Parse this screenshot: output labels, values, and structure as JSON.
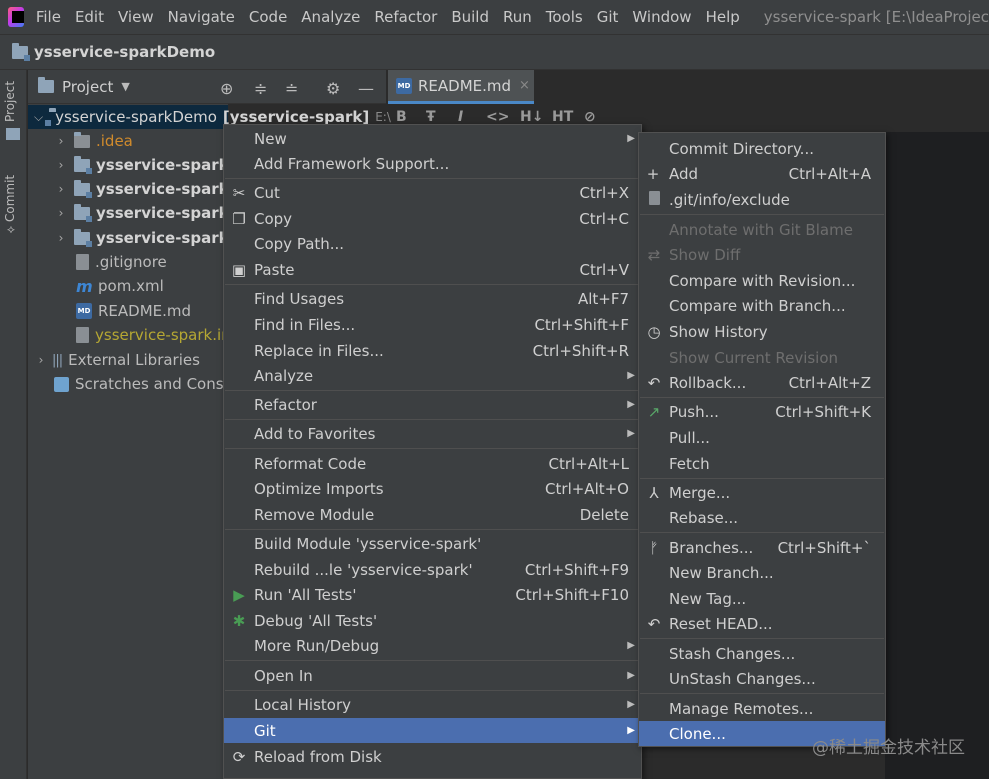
{
  "menubar": {
    "items": [
      "File",
      "Edit",
      "View",
      "Navigate",
      "Code",
      "Analyze",
      "Refactor",
      "Build",
      "Run",
      "Tools",
      "Git",
      "Window",
      "Help"
    ],
    "window_title": "ysservice-spark [E:\\IdeaProjec"
  },
  "project_bar": {
    "name": "ysservice-sparkDemo"
  },
  "left_strip": {
    "project_tab": "Project",
    "commit_tab": "Commit"
  },
  "tool_window": {
    "title": "Project"
  },
  "editor_tab": {
    "icon_text": "MD",
    "label": "README.md",
    "close": "×"
  },
  "editor_toolbar": [
    "B",
    "Ŧ",
    "I",
    "<>",
    "H↓",
    "HT",
    "⊘"
  ],
  "tree": {
    "root_label": "ysservice-sparkDemo",
    "root_bracket": "[ysservice-spark]",
    "root_path": "E:\\",
    "idea": ".idea",
    "modules": [
      "ysservice-spark-",
      "ysservice-spark-",
      "ysservice-spark-",
      "ysservice-spark-"
    ],
    "gitignore": ".gitignore",
    "pom": "pom.xml",
    "readme": "README.md",
    "iml": "ysservice-spark.im",
    "external_libraries": "External Libraries",
    "scratches": "Scratches and Conso"
  },
  "context_menu": {
    "items": [
      {
        "label": "New",
        "shortcut": "",
        "submenu": true
      },
      {
        "label": "Add Framework Support...",
        "shortcut": ""
      },
      {
        "label": "Cut",
        "shortcut": "Ctrl+X",
        "icon": "scissors-icon"
      },
      {
        "label": "Copy",
        "shortcut": "Ctrl+C",
        "icon": "copy-icon"
      },
      {
        "label": "Copy Path...",
        "shortcut": ""
      },
      {
        "label": "Paste",
        "shortcut": "Ctrl+V",
        "icon": "paste-icon"
      },
      {
        "label": "Find Usages",
        "shortcut": "Alt+F7"
      },
      {
        "label": "Find in Files...",
        "shortcut": "Ctrl+Shift+F"
      },
      {
        "label": "Replace in Files...",
        "shortcut": "Ctrl+Shift+R"
      },
      {
        "label": "Analyze",
        "shortcut": "",
        "submenu": true
      },
      {
        "label": "Refactor",
        "shortcut": "",
        "submenu": true
      },
      {
        "label": "Add to Favorites",
        "shortcut": "",
        "submenu": true
      },
      {
        "label": "Reformat Code",
        "shortcut": "Ctrl+Alt+L"
      },
      {
        "label": "Optimize Imports",
        "shortcut": "Ctrl+Alt+O"
      },
      {
        "label": "Remove Module",
        "shortcut": "Delete"
      },
      {
        "label": "Build Module 'ysservice-spark'",
        "shortcut": ""
      },
      {
        "label": "Rebuild ...le 'ysservice-spark'",
        "shortcut": "Ctrl+Shift+F9"
      },
      {
        "label": "Run 'All Tests'",
        "shortcut": "Ctrl+Shift+F10",
        "icon": "run-icon"
      },
      {
        "label": "Debug 'All Tests'",
        "shortcut": "",
        "icon": "bug-icon"
      },
      {
        "label": "More Run/Debug",
        "shortcut": "",
        "submenu": true
      },
      {
        "label": "Open In",
        "shortcut": "",
        "submenu": true
      },
      {
        "label": "Local History",
        "shortcut": "",
        "submenu": true
      },
      {
        "label": "Git",
        "shortcut": "",
        "submenu": true,
        "highlighted": true
      },
      {
        "label": "Reload from Disk",
        "shortcut": "",
        "icon": "reload-icon"
      }
    ]
  },
  "git_submenu": {
    "items": [
      {
        "label": "Commit Directory...",
        "shortcut": ""
      },
      {
        "label": "Add",
        "shortcut": "Ctrl+Alt+A",
        "icon": "plus-icon"
      },
      {
        "label": ".git/info/exclude",
        "shortcut": "",
        "icon": "file-icon"
      },
      {
        "label": "Annotate with Git Blame",
        "shortcut": "",
        "disabled": true
      },
      {
        "label": "Show Diff",
        "shortcut": "",
        "disabled": true,
        "icon": "diff-icon"
      },
      {
        "label": "Compare with Revision...",
        "shortcut": ""
      },
      {
        "label": "Compare with Branch...",
        "shortcut": ""
      },
      {
        "label": "Show History",
        "shortcut": "",
        "icon": "clock-icon"
      },
      {
        "label": "Show Current Revision",
        "shortcut": "",
        "disabled": true
      },
      {
        "label": "Rollback...",
        "shortcut": "Ctrl+Alt+Z",
        "icon": "undo-icon"
      },
      {
        "label": "Push...",
        "shortcut": "Ctrl+Shift+K",
        "icon": "push-arrow-icon"
      },
      {
        "label": "Pull...",
        "shortcut": ""
      },
      {
        "label": "Fetch",
        "shortcut": ""
      },
      {
        "label": "Merge...",
        "shortcut": "",
        "icon": "merge-icon"
      },
      {
        "label": "Rebase...",
        "shortcut": ""
      },
      {
        "label": "Branches...",
        "shortcut": "Ctrl+Shift+`",
        "icon": "branch-icon"
      },
      {
        "label": "New Branch...",
        "shortcut": ""
      },
      {
        "label": "New Tag...",
        "shortcut": ""
      },
      {
        "label": "Reset HEAD...",
        "shortcut": "",
        "icon": "undo-icon"
      },
      {
        "label": "Stash Changes...",
        "shortcut": ""
      },
      {
        "label": "UnStash Changes...",
        "shortcut": ""
      },
      {
        "label": "Manage Remotes...",
        "shortcut": ""
      },
      {
        "label": "Clone...",
        "shortcut": "",
        "highlighted": true
      }
    ]
  },
  "watermark": "@稀土掘金技术社区",
  "colors": {
    "menu_bg": "#3c3f41",
    "highlight": "#4b6eaf",
    "selection": "#0d293e",
    "editor_bg": "#2b2b2b",
    "disabled_text": "#6e6e6e",
    "push_green": "#59a869",
    "run_green": "#499c54"
  }
}
